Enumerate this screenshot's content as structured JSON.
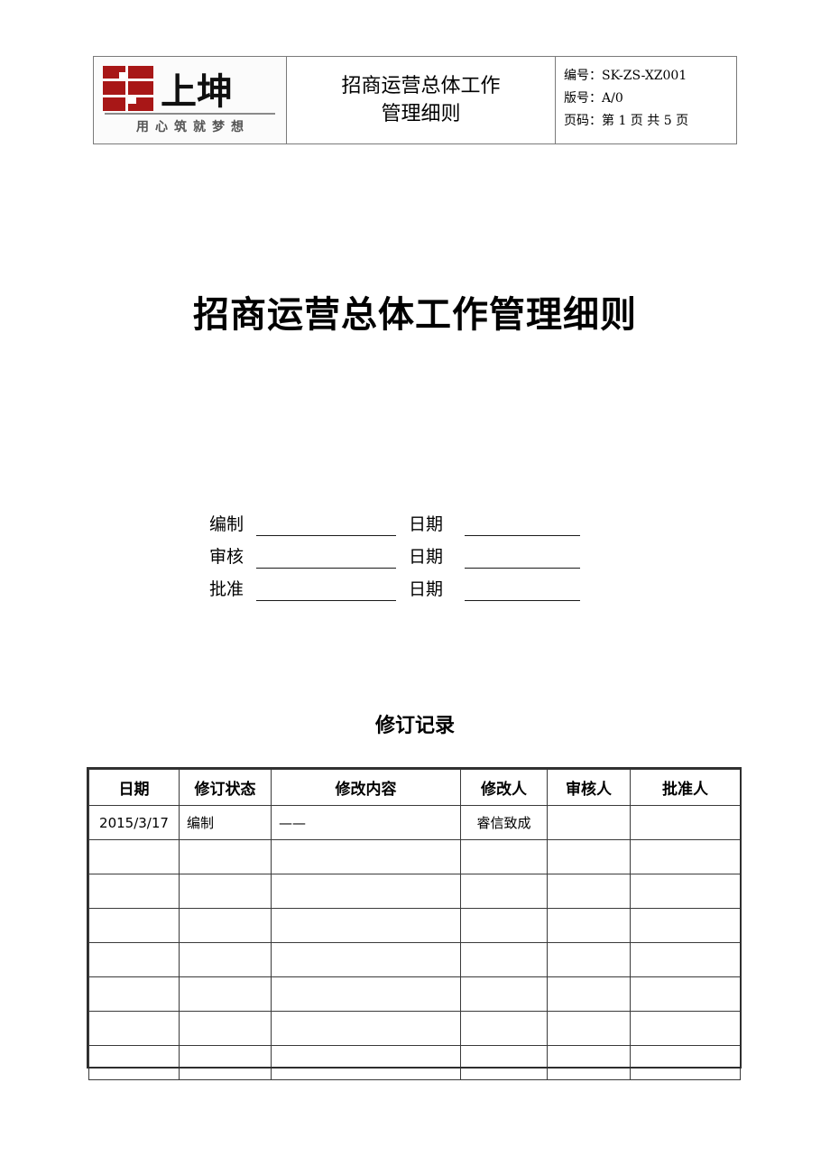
{
  "header": {
    "logo": {
      "mark_color": "#a81717",
      "brand": "上坤",
      "tagline": "用心筑就梦想"
    },
    "doc_title_line1": "招商运营总体工作",
    "doc_title_line2": "管理细则",
    "meta": {
      "code_label": "编号：",
      "code_value": "SK-ZS-XZ001",
      "version_label": "版号：",
      "version_value": "A/0",
      "page_label": "页码：",
      "page_value": "第 1 页 共 5 页"
    }
  },
  "main_title": "招商运营总体工作管理细则",
  "signature": {
    "rows": [
      {
        "label": "编制",
        "date_label": "日期",
        "value": "",
        "date_value": ""
      },
      {
        "label": "审核",
        "date_label": "日期",
        "value": "",
        "date_value": ""
      },
      {
        "label": "批准",
        "date_label": "日期",
        "value": "",
        "date_value": ""
      }
    ]
  },
  "revision": {
    "heading": "修订记录",
    "columns": [
      "日期",
      "修订状态",
      "修改内容",
      "修改人",
      "审核人",
      "批准人"
    ],
    "rows": [
      {
        "date": "2015/3/17",
        "state": "编制",
        "content": "——",
        "modifier": "睿信致成",
        "reviewer": "",
        "approver": ""
      },
      {
        "date": "",
        "state": "",
        "content": "",
        "modifier": "",
        "reviewer": "",
        "approver": ""
      },
      {
        "date": "",
        "state": "",
        "content": "",
        "modifier": "",
        "reviewer": "",
        "approver": ""
      },
      {
        "date": "",
        "state": "",
        "content": "",
        "modifier": "",
        "reviewer": "",
        "approver": ""
      },
      {
        "date": "",
        "state": "",
        "content": "",
        "modifier": "",
        "reviewer": "",
        "approver": ""
      },
      {
        "date": "",
        "state": "",
        "content": "",
        "modifier": "",
        "reviewer": "",
        "approver": ""
      },
      {
        "date": "",
        "state": "",
        "content": "",
        "modifier": "",
        "reviewer": "",
        "approver": ""
      },
      {
        "date": "",
        "state": "",
        "content": "",
        "modifier": "",
        "reviewer": "",
        "approver": ""
      }
    ]
  }
}
